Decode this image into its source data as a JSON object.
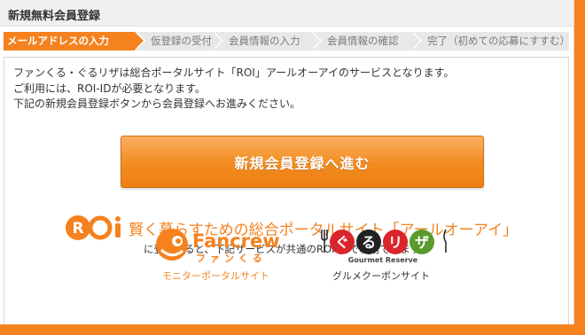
{
  "header": {
    "title": "新規無料会員登録"
  },
  "steps": [
    {
      "label": "メールアドレスの入力",
      "active": true
    },
    {
      "label": "仮登録の受付",
      "active": false
    },
    {
      "label": "会員情報の入力",
      "active": false
    },
    {
      "label": "会員情報の確認",
      "active": false
    },
    {
      "label": "完了（初めての応募にすすむ）",
      "active": false
    }
  ],
  "intro": [
    "ファンくる・ぐるリザは総合ポータルサイト「ROI」アールオーアイのサービスとなります。",
    "ご利用には、ROI-IDが必要となります。",
    "下記の新規会員登録ボタンから会員登録へお進みください。"
  ],
  "cta": {
    "label": "新規会員登録へ進む"
  },
  "roi": {
    "logo_text": "ROI",
    "tagline": "賢く暮らすための総合ポータルサイト「アールオーアイ」",
    "sub": "に登録すると、下記サービスが共通のROI-IDで利用できます。"
  },
  "services": {
    "fancrew": {
      "caption": "モニターポータルサイト",
      "logo_en": "Fancrew",
      "logo_jp": "ファンくる"
    },
    "gururiza": {
      "caption": "グルメクーポンサイト",
      "logo_chars": [
        "ぐ",
        "る",
        "リ",
        "ザ"
      ],
      "logo_sub": "Gourmet Reserve"
    }
  },
  "colors": {
    "accent": "#f5821f",
    "step_inactive": "#e8e8e8",
    "red": "#d9262c",
    "green": "#5a9a2b",
    "black": "#222222"
  }
}
